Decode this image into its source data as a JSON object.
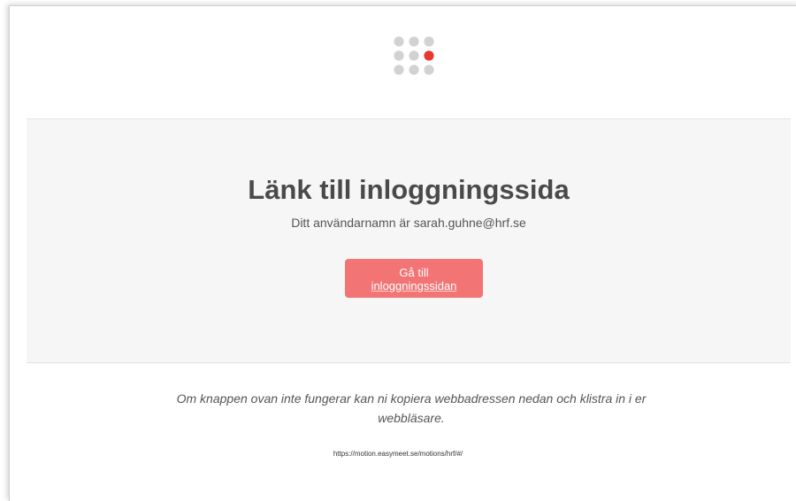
{
  "logo": {
    "icon": "dot-grid-logo-icon",
    "dot_color": "#d2d2d2",
    "accent_color": "#e8392f"
  },
  "main": {
    "title": "Länk till inloggningssida",
    "username_text": "Ditt användarnamn är sarah.guhne@hrf.se",
    "button": {
      "line1": "Gå till",
      "line2": "inloggningssidan",
      "color": "#f27474"
    }
  },
  "footer": {
    "help_line1": "Om knappen ovan inte fungerar kan ni kopiera webbadressen nedan och klistra in i er",
    "help_line2": "webbläsare.",
    "url": "https://motion.easymeet.se/motions/hrf/#/"
  }
}
